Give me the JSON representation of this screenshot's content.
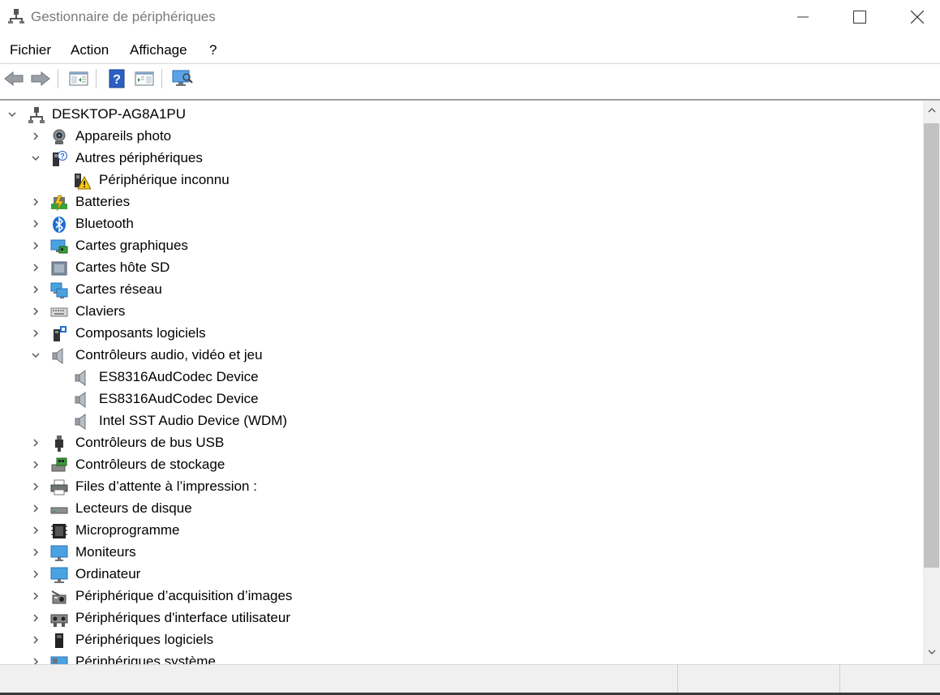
{
  "window": {
    "title": "Gestionnaire de périphériques"
  },
  "menu": [
    "Fichier",
    "Action",
    "Affichage",
    "?"
  ],
  "tree": {
    "root": "DESKTOP-AG8A1PU",
    "items": [
      {
        "label": "Appareils photo",
        "level": 1,
        "expanded": false,
        "icon": "camera-icon"
      },
      {
        "label": "Autres périphériques",
        "level": 1,
        "expanded": true,
        "icon": "other-devices-icon"
      },
      {
        "label": "Périphérique inconnu",
        "level": 2,
        "icon": "unknown-device-warning-icon"
      },
      {
        "label": "Batteries",
        "level": 1,
        "expanded": false,
        "icon": "battery-icon"
      },
      {
        "label": "Bluetooth",
        "level": 1,
        "expanded": false,
        "icon": "bluetooth-icon"
      },
      {
        "label": "Cartes graphiques",
        "level": 1,
        "expanded": false,
        "icon": "display-adapter-icon"
      },
      {
        "label": "Cartes hôte SD",
        "level": 1,
        "expanded": false,
        "icon": "sd-host-icon"
      },
      {
        "label": "Cartes réseau",
        "level": 1,
        "expanded": false,
        "icon": "network-adapter-icon"
      },
      {
        "label": "Claviers",
        "level": 1,
        "expanded": false,
        "icon": "keyboard-icon"
      },
      {
        "label": "Composants logiciels",
        "level": 1,
        "expanded": false,
        "icon": "software-component-icon"
      },
      {
        "label": "Contrôleurs audio, vidéo et jeu",
        "level": 1,
        "expanded": true,
        "icon": "speaker-icon"
      },
      {
        "label": "ES8316AudCodec Device",
        "level": 2,
        "icon": "speaker-icon"
      },
      {
        "label": "ES8316AudCodec Device",
        "level": 2,
        "icon": "speaker-icon"
      },
      {
        "label": "Intel SST Audio Device (WDM)",
        "level": 2,
        "icon": "speaker-icon"
      },
      {
        "label": "Contrôleurs de bus USB",
        "level": 1,
        "expanded": false,
        "icon": "usb-icon"
      },
      {
        "label": "Contrôleurs de stockage",
        "level": 1,
        "expanded": false,
        "icon": "storage-controller-icon"
      },
      {
        "label": "Files d’attente à l’impression :",
        "level": 1,
        "expanded": false,
        "icon": "printer-icon"
      },
      {
        "label": "Lecteurs de disque",
        "level": 1,
        "expanded": false,
        "icon": "disk-drive-icon"
      },
      {
        "label": "Microprogramme",
        "level": 1,
        "expanded": false,
        "icon": "firmware-icon"
      },
      {
        "label": "Moniteurs",
        "level": 1,
        "expanded": false,
        "icon": "monitor-icon"
      },
      {
        "label": "Ordinateur",
        "level": 1,
        "expanded": false,
        "icon": "computer-icon"
      },
      {
        "label": "Périphérique d’acquisition d’images",
        "level": 1,
        "expanded": false,
        "icon": "imaging-device-icon"
      },
      {
        "label": "Périphériques d'interface utilisateur",
        "level": 1,
        "expanded": false,
        "icon": "hid-icon"
      },
      {
        "label": "Périphériques logiciels",
        "level": 1,
        "expanded": false,
        "icon": "software-device-icon"
      },
      {
        "label": "Périphériques système",
        "level": 1,
        "expanded": false,
        "icon": "system-device-icon"
      }
    ]
  },
  "colors": {
    "accent_blue": "#1e6fd0",
    "chevron": "#555555",
    "title_text": "#7a7a7a"
  }
}
